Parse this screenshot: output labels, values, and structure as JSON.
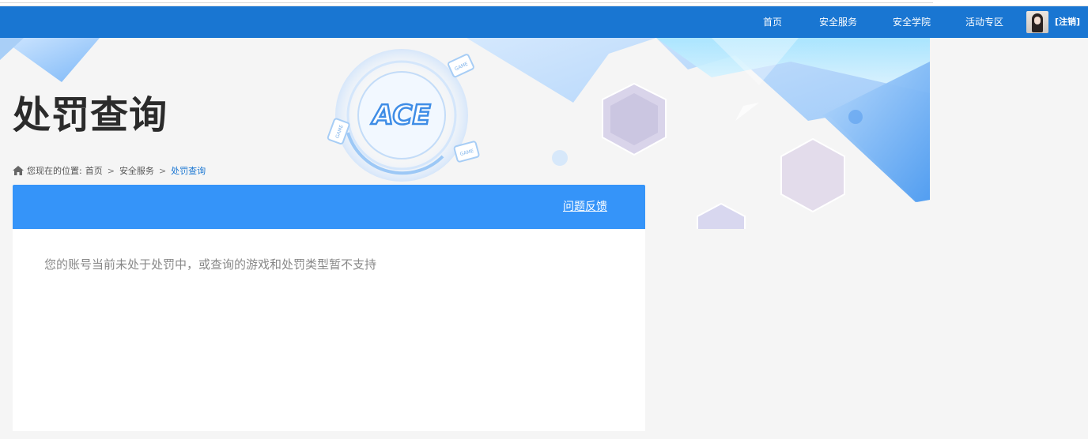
{
  "nav": {
    "items": [
      {
        "label": "首页"
      },
      {
        "label": "安全服务"
      },
      {
        "label": "安全学院"
      },
      {
        "label": "活动专区"
      }
    ],
    "logout_label": "[注销]",
    "background_color": "#1976d2"
  },
  "page": {
    "title": "处罚查询"
  },
  "breadcrumb": {
    "prefix": "您现在的位置:",
    "items": [
      "首页",
      "安全服务",
      "处罚查询"
    ],
    "separator": ">"
  },
  "card": {
    "feedback_label": "问题反馈",
    "message": "您的账号当前未处于处罚中，或查询的游戏和处罚类型暂不支持",
    "header_color": "#3594f9"
  },
  "banner": {
    "logo_text": "ACE",
    "badge_text": "GAME"
  },
  "icons": {
    "home": "home-icon",
    "avatar": "avatar"
  }
}
